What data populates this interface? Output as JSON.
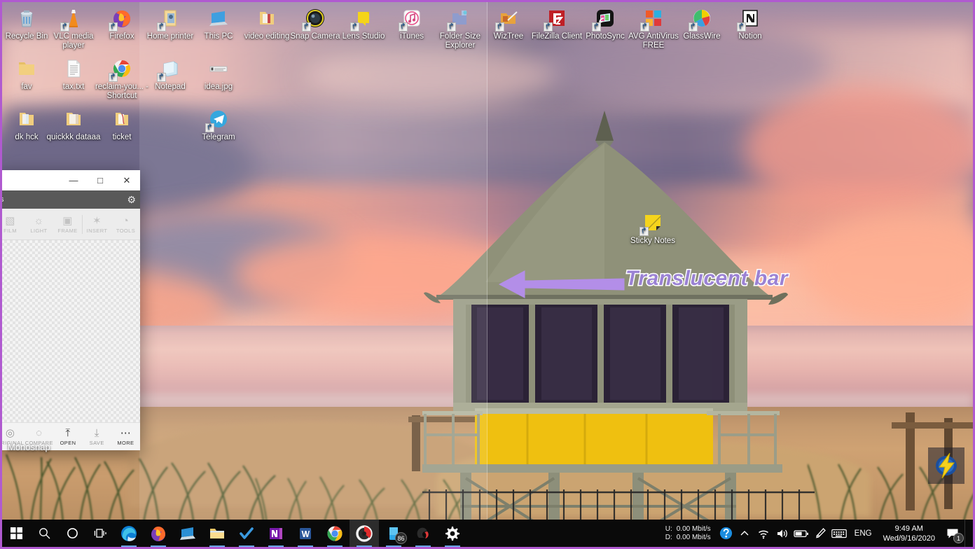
{
  "desktop": {
    "icons_row1": [
      {
        "label": "Recycle Bin",
        "icon": "recycle-bin-icon",
        "shortcut": false
      },
      {
        "label": "VLC media player",
        "icon": "vlc-icon",
        "shortcut": true
      },
      {
        "label": "Firefox",
        "icon": "firefox-icon",
        "shortcut": true
      },
      {
        "label": "Home printer",
        "icon": "printer-icon",
        "shortcut": true
      },
      {
        "label": "This PC",
        "icon": "this-pc-icon",
        "shortcut": false
      },
      {
        "label": "video editing",
        "icon": "folder-icon",
        "shortcut": false
      },
      {
        "label": "Snap Camera",
        "icon": "snap-camera-icon",
        "shortcut": true
      },
      {
        "label": "Lens Studio",
        "icon": "lens-studio-icon",
        "shortcut": true
      },
      {
        "label": "iTunes",
        "icon": "itunes-icon",
        "shortcut": true
      },
      {
        "label": "Folder Size Explorer",
        "icon": "folder-size-explorer-icon",
        "shortcut": true
      },
      {
        "label": "WizTree",
        "icon": "wiztree-icon",
        "shortcut": true
      },
      {
        "label": "FileZilla Client",
        "icon": "filezilla-icon",
        "shortcut": true
      },
      {
        "label": "PhotoSync",
        "icon": "photosync-icon",
        "shortcut": true
      },
      {
        "label": "AVG AntiVirus FREE",
        "icon": "avg-antivirus-icon",
        "shortcut": true
      },
      {
        "label": "GlassWire",
        "icon": "glasswire-icon",
        "shortcut": true
      },
      {
        "label": "Notion",
        "icon": "notion-icon",
        "shortcut": true
      }
    ],
    "icons_row2": [
      {
        "label": "fav",
        "icon": "folder-icon",
        "shortcut": false
      },
      {
        "label": "tax.txt",
        "icon": "text-file-icon",
        "shortcut": false
      },
      {
        "label": "reclaim-you... - Shortcut",
        "icon": "chrome-icon",
        "shortcut": true
      },
      {
        "label": "Notepad",
        "icon": "notepad-icon",
        "shortcut": true
      },
      {
        "label": "idea.jpg",
        "icon": "image-file-icon",
        "shortcut": false
      }
    ],
    "icons_row3": [
      {
        "label": "dk hck",
        "icon": "folder-icon",
        "shortcut": false
      },
      {
        "label": "quickkk dataaa",
        "icon": "folder-icon",
        "shortcut": false
      },
      {
        "label": "ticket",
        "icon": "folder-icon",
        "shortcut": false
      },
      {
        "label": "Telegram",
        "icon": "telegram-icon",
        "shortcut": true
      }
    ],
    "sticky_notes": {
      "label": "Sticky Notes",
      "icon": "sticky-notes-icon",
      "shortcut": true
    },
    "power_widget": {
      "icon": "lightning-bolt-icon"
    }
  },
  "annotation": {
    "text": "Translucent bar",
    "color": "#9b82d4",
    "outline_color": "#ffffff",
    "arrow_direction": "left"
  },
  "editor_window": {
    "app_name": "Monosnap",
    "titlebar": {
      "minimize": "—",
      "maximize": "□",
      "close": "✕"
    },
    "tabbar": {
      "partial_label": "s",
      "settings_icon": "gear-icon"
    },
    "tools": [
      {
        "label": "FILM",
        "icon": "film-icon",
        "glyph": "▧"
      },
      {
        "label": "LIGHT",
        "icon": "brightness-icon",
        "glyph": "☀"
      },
      {
        "label": "FRAME",
        "icon": "frame-icon",
        "glyph": "▣"
      },
      {
        "label": "INSERT",
        "icon": "insert-icon",
        "glyph": "✦"
      },
      {
        "label": "TOOLS",
        "icon": "palette-icon",
        "glyph": "◔"
      }
    ],
    "bottom_actions": [
      {
        "label": "ORIGINAL",
        "icon": "original-icon",
        "glyph": "◎",
        "enabled": false
      },
      {
        "label": "COMPARE",
        "icon": "compare-icon",
        "glyph": "◌",
        "enabled": false
      },
      {
        "label": "OPEN",
        "icon": "open-icon",
        "glyph": "↑",
        "enabled": true
      },
      {
        "label": "SAVE",
        "icon": "save-icon",
        "glyph": "↓",
        "enabled": false
      },
      {
        "label": "MORE",
        "icon": "more-icon",
        "glyph": "•••",
        "enabled": true
      }
    ]
  },
  "taskbar": {
    "left_items": [
      {
        "name": "start-button",
        "icon": "windows-logo-icon",
        "running": false
      },
      {
        "name": "search-button",
        "icon": "search-icon",
        "running": false
      },
      {
        "name": "cortana-button",
        "icon": "cortana-circle-icon",
        "running": false
      },
      {
        "name": "task-view-button",
        "icon": "task-view-icon",
        "running": false
      },
      {
        "name": "taskbar-edge",
        "icon": "edge-icon",
        "running": true
      },
      {
        "name": "taskbar-firefox",
        "icon": "firefox-icon",
        "running": true
      },
      {
        "name": "taskbar-remote-desktop",
        "icon": "remote-desktop-icon",
        "running": false
      },
      {
        "name": "taskbar-file-explorer",
        "icon": "file-explorer-icon",
        "running": true
      },
      {
        "name": "taskbar-todo",
        "icon": "todo-check-icon",
        "running": true
      },
      {
        "name": "taskbar-onenote",
        "icon": "onenote-icon",
        "running": true
      },
      {
        "name": "taskbar-word",
        "icon": "word-icon",
        "running": true
      },
      {
        "name": "taskbar-chrome",
        "icon": "chrome-icon",
        "running": true
      },
      {
        "name": "taskbar-monosnap",
        "icon": "monosnap-icon",
        "running": true,
        "active": true
      },
      {
        "name": "taskbar-your-phone",
        "icon": "your-phone-icon",
        "running": true,
        "badge": "86"
      },
      {
        "name": "taskbar-netskope",
        "icon": "netskope-icon",
        "running": true
      },
      {
        "name": "taskbar-settings",
        "icon": "gear-icon",
        "running": true
      }
    ],
    "network_meter": {
      "upload_key": "U:",
      "download_key": "D:",
      "upload_value": "0.00 Mbit/s",
      "download_value": "0.00 Mbit/s"
    },
    "tray_icons": [
      {
        "name": "help-icon",
        "glyph": "?"
      },
      {
        "name": "show-hidden-icons-chevron-icon",
        "glyph": "∧"
      },
      {
        "name": "wifi-icon",
        "glyph": "📶"
      },
      {
        "name": "volume-icon",
        "glyph": "🔊"
      },
      {
        "name": "battery-icon",
        "glyph": "▭"
      },
      {
        "name": "pen-icon",
        "glyph": "✎"
      },
      {
        "name": "keyboard-icon",
        "glyph": "⌨"
      }
    ],
    "language": "ENG",
    "time": "9:49 AM",
    "date": "Wed/9/16/2020",
    "notification_count": "1"
  }
}
